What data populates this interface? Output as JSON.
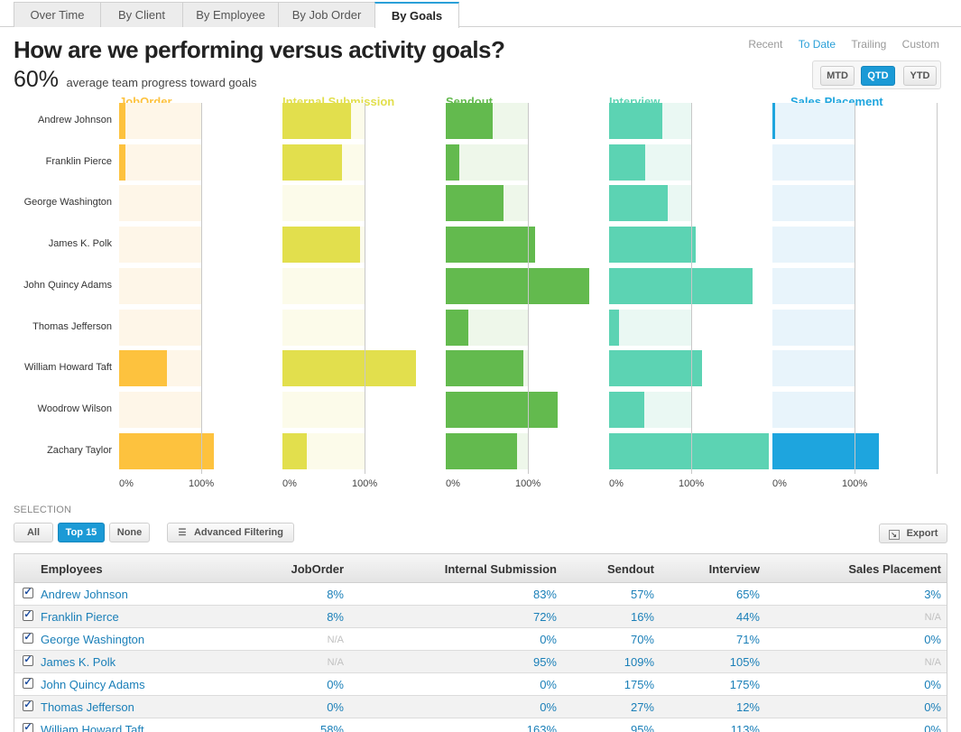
{
  "tabs": [
    "Over Time",
    "By Client",
    "By Employee",
    "By Job Order",
    "By Goals"
  ],
  "active_tab": "By Goals",
  "title": "How are we performing versus activity goals?",
  "progress": {
    "value": "60%",
    "label": "average team progress toward goals"
  },
  "range_links": [
    "Recent",
    "To Date",
    "Trailing",
    "Custom"
  ],
  "active_range": "To Date",
  "period_buttons": [
    "MTD",
    "QTD",
    "YTD"
  ],
  "active_period": "QTD",
  "colors": {
    "accent": "#1b9ad6",
    "joborder": "#fdc23e",
    "internal": "#e2df4d",
    "sendout": "#63ba4e",
    "interview": "#5cd3b3",
    "placement": "#1ea5de"
  },
  "chart_data": {
    "type": "bar",
    "orientation": "horizontal",
    "categories": [
      "Andrew Johnson",
      "Franklin Pierce",
      "George Washington",
      "James K. Polk",
      "John Quincy Adams",
      "Thomas Jefferson",
      "William Howard Taft",
      "Woodrow Wilson",
      "Zachary Taylor"
    ],
    "xlim": [
      0,
      100
    ],
    "tick_labels": [
      "0%",
      "100%"
    ],
    "series": [
      {
        "name": "JobOrder",
        "values": [
          8,
          8,
          null,
          null,
          0,
          0,
          58,
          null,
          115
        ]
      },
      {
        "name": "Internal Submission",
        "values": [
          83,
          72,
          0,
          95,
          0,
          0,
          163,
          0,
          30
        ]
      },
      {
        "name": "Sendout",
        "values": [
          57,
          16,
          70,
          109,
          175,
          27,
          95,
          136,
          87
        ]
      },
      {
        "name": "Interview",
        "values": [
          65,
          44,
          71,
          105,
          175,
          12,
          113,
          43,
          195
        ]
      },
      {
        "name": "Sales Placement",
        "values": [
          3,
          null,
          0,
          null,
          0,
          0,
          0,
          0,
          130
        ]
      }
    ]
  },
  "selection": {
    "label": "SELECTION",
    "buttons": [
      "All",
      "Top 15",
      "None"
    ],
    "active": "Top 15",
    "advanced_filtering": "Advanced Filtering",
    "export": "Export"
  },
  "table": {
    "columns": [
      "Employees",
      "JobOrder",
      "Internal Submission",
      "Sendout",
      "Interview",
      "Sales Placement"
    ],
    "rows": [
      [
        "Andrew Johnson",
        "8%",
        "83%",
        "57%",
        "65%",
        "3%"
      ],
      [
        "Franklin Pierce",
        "8%",
        "72%",
        "16%",
        "44%",
        "N/A"
      ],
      [
        "George Washington",
        "N/A",
        "0%",
        "70%",
        "71%",
        "0%"
      ],
      [
        "James K. Polk",
        "N/A",
        "95%",
        "109%",
        "105%",
        "N/A"
      ],
      [
        "John Quincy Adams",
        "0%",
        "0%",
        "175%",
        "175%",
        "0%"
      ],
      [
        "Thomas Jefferson",
        "0%",
        "0%",
        "27%",
        "12%",
        "0%"
      ],
      [
        "William Howard Taft",
        "58%",
        "163%",
        "95%",
        "113%",
        "0%"
      ]
    ]
  }
}
